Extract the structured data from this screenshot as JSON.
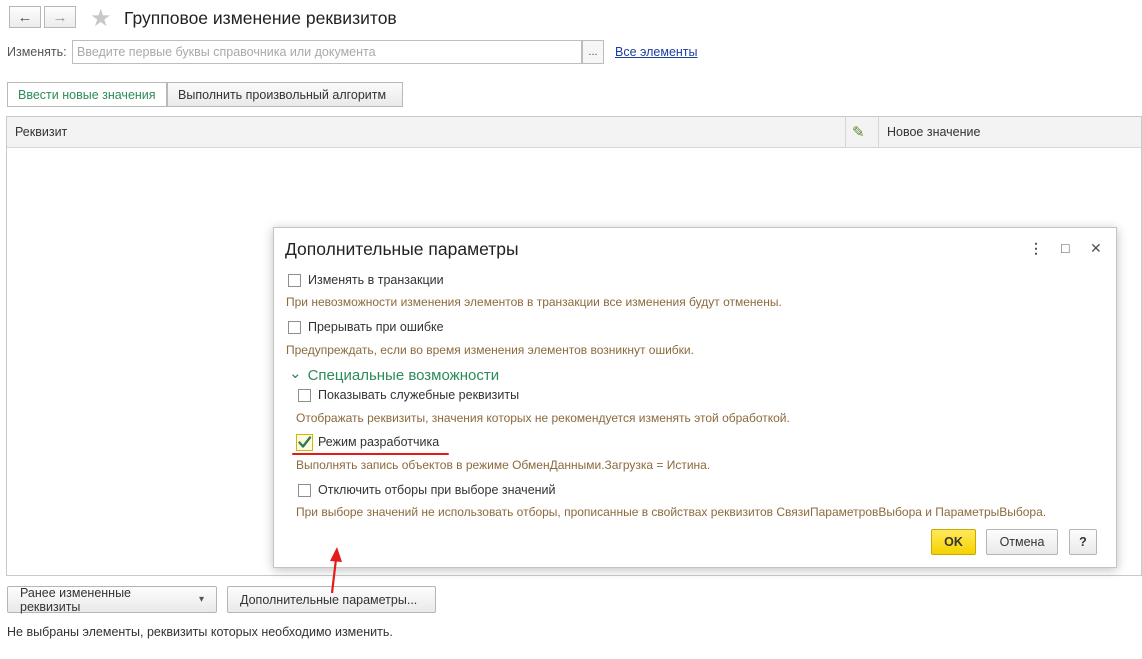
{
  "window": {
    "title": "Групповое изменение реквизитов",
    "back_icon": "←",
    "forward_icon": "→",
    "favorite_icon": "★"
  },
  "filter": {
    "label": "Изменять:",
    "placeholder": "Введите первые буквы справочника или документа",
    "value": "",
    "select_button": "...",
    "all_elements_link": "Все элементы"
  },
  "tabs": [
    {
      "label": "Ввести новые значения",
      "active": true
    },
    {
      "label": "Выполнить произвольный алгоритм",
      "active": false
    }
  ],
  "grid": {
    "columns": [
      "Реквизит",
      "Новое значение"
    ],
    "edit_icon": "✎"
  },
  "bottom": {
    "previous_button": "Ранее измененные реквизиты",
    "previous_dropdown_icon": "▾",
    "params_button": "Дополнительные параметры...",
    "status_text": "Не выбраны элементы, реквизиты которых необходимо изменить."
  },
  "dialog": {
    "title": "Дополнительные параметры",
    "more_icon": "⋮",
    "maximize_icon": "□",
    "close_icon": "✕",
    "options": [
      {
        "label": "Изменять в транзакции",
        "checked": false,
        "hint": "При невозможности изменения элементов в транзакции все изменения будут отменены."
      },
      {
        "label": "Прерывать при ошибке",
        "checked": false,
        "hint": "Предупреждать, если во время изменения элементов возникнут ошибки."
      }
    ],
    "section_title": "Специальные возможности",
    "section_icon": "⌄",
    "special_options": [
      {
        "label": "Показывать служебные реквизиты",
        "checked": false,
        "hint": "Отображать реквизиты, значения которых не рекомендуется изменять этой обработкой."
      },
      {
        "label": "Режим разработчика",
        "checked": true,
        "hint": "Выполнять запись объектов в режиме ОбменДанными.Загрузка = Истина."
      },
      {
        "label": "Отключить отборы при выборе значений",
        "checked": false,
        "hint": "При выборе значений не использовать отборы, прописанные в свойствах реквизитов СвязиПараметровВыбора и ПараметрыВыбора."
      }
    ],
    "ok_button": "OK",
    "cancel_button": "Отмена",
    "help_button": "?"
  },
  "annotation_color": "#e31b1b",
  "accent_color": "#2e8b57"
}
